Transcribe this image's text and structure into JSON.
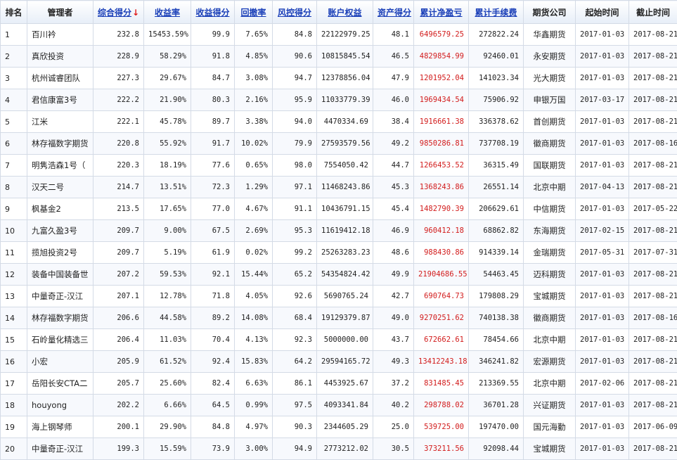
{
  "headers": [
    {
      "label": "排名",
      "sortable": false
    },
    {
      "label": "管理者",
      "sortable": false
    },
    {
      "label": "综合得分",
      "sortable": true,
      "sort_arrow": "↓"
    },
    {
      "label": "收益率",
      "sortable": true
    },
    {
      "label": "收益得分",
      "sortable": true
    },
    {
      "label": "回撤率",
      "sortable": true
    },
    {
      "label": "风控得分",
      "sortable": true
    },
    {
      "label": "账户权益",
      "sortable": true
    },
    {
      "label": "资产得分",
      "sortable": true
    },
    {
      "label": "累计净盈亏",
      "sortable": true
    },
    {
      "label": "累计手续费",
      "sortable": true
    },
    {
      "label": "期货公司",
      "sortable": false
    },
    {
      "label": "起始时间",
      "sortable": false
    },
    {
      "label": "截止时间",
      "sortable": false
    }
  ],
  "colors": {
    "link": "#1a3fb8",
    "profit": "#d21c1c",
    "sort_arrow": "#e01b1b"
  },
  "rows": [
    [
      "1",
      "百川衿",
      "232.8",
      "15453.59%",
      "99.9",
      "7.65%",
      "84.8",
      "22122979.25",
      "48.1",
      "6496579.25",
      "272822.24",
      "华鑫期货",
      "2017-01-03",
      "2017-08-21"
    ],
    [
      "2",
      "真欣投资",
      "228.9",
      "58.29%",
      "91.8",
      "4.85%",
      "90.6",
      "10815845.54",
      "46.5",
      "4829854.99",
      "92460.01",
      "永安期货",
      "2017-01-03",
      "2017-08-21"
    ],
    [
      "3",
      "杭州诚睿团队",
      "227.3",
      "29.67%",
      "84.7",
      "3.08%",
      "94.7",
      "12378856.04",
      "47.9",
      "1201952.04",
      "141023.34",
      "光大期货",
      "2017-01-03",
      "2017-08-21"
    ],
    [
      "4",
      "君信康富3号",
      "222.2",
      "21.90%",
      "80.3",
      "2.16%",
      "95.9",
      "11033779.39",
      "46.0",
      "1969434.54",
      "75906.92",
      "申银万国",
      "2017-03-17",
      "2017-08-21"
    ],
    [
      "5",
      "江米",
      "222.1",
      "45.78%",
      "89.7",
      "3.38%",
      "94.0",
      "4470334.69",
      "38.4",
      "1916661.38",
      "336378.62",
      "首创期货",
      "2017-01-03",
      "2017-08-21"
    ],
    [
      "6",
      "林存福数字期货",
      "220.8",
      "55.92%",
      "91.7",
      "10.02%",
      "79.9",
      "27593579.56",
      "49.2",
      "9850286.81",
      "737708.19",
      "徽商期货",
      "2017-01-03",
      "2017-08-16"
    ],
    [
      "7",
      "明隽浩森1号（",
      "220.3",
      "18.19%",
      "77.6",
      "0.65%",
      "98.0",
      "7554050.42",
      "44.7",
      "1266453.52",
      "36315.49",
      "国联期货",
      "2017-01-03",
      "2017-08-21"
    ],
    [
      "8",
      "汉天二号",
      "214.7",
      "13.51%",
      "72.3",
      "1.29%",
      "97.1",
      "11468243.86",
      "45.3",
      "1368243.86",
      "26551.14",
      "北京中期",
      "2017-04-13",
      "2017-08-21"
    ],
    [
      "9",
      "枫基金2",
      "213.5",
      "17.65%",
      "77.0",
      "4.67%",
      "91.1",
      "10436791.15",
      "45.4",
      "1482790.39",
      "206629.61",
      "中信期货",
      "2017-01-03",
      "2017-05-22"
    ],
    [
      "10",
      "九富久盈3号",
      "209.7",
      "9.00%",
      "67.5",
      "2.69%",
      "95.3",
      "11619412.18",
      "46.9",
      "960412.18",
      "68862.82",
      "东海期货",
      "2017-02-15",
      "2017-08-21"
    ],
    [
      "11",
      "揽旭投资2号",
      "209.7",
      "5.19%",
      "61.9",
      "0.02%",
      "99.2",
      "25263283.23",
      "48.6",
      "988430.86",
      "914339.14",
      "金瑞期货",
      "2017-05-31",
      "2017-07-31"
    ],
    [
      "12",
      "装备中国装备世",
      "207.2",
      "59.53%",
      "92.1",
      "15.44%",
      "65.2",
      "54354824.42",
      "49.9",
      "21904686.55",
      "54463.45",
      "迈科期货",
      "2017-01-03",
      "2017-08-21"
    ],
    [
      "13",
      "中量奇正-汉江",
      "207.1",
      "12.78%",
      "71.8",
      "4.05%",
      "92.6",
      "5690765.24",
      "42.7",
      "690764.73",
      "179808.29",
      "宝城期货",
      "2017-01-03",
      "2017-08-21"
    ],
    [
      "14",
      "林存福数字期货",
      "206.6",
      "44.58%",
      "89.2",
      "14.08%",
      "68.4",
      "19129379.87",
      "49.0",
      "9270251.62",
      "740138.38",
      "徽商期货",
      "2017-01-03",
      "2017-08-16"
    ],
    [
      "15",
      "石岭量化精选三",
      "206.4",
      "11.03%",
      "70.4",
      "4.13%",
      "92.3",
      "5000000.00",
      "43.7",
      "672662.61",
      "78454.66",
      "北京中期",
      "2017-01-03",
      "2017-08-21"
    ],
    [
      "16",
      "小宏",
      "205.9",
      "61.52%",
      "92.4",
      "15.83%",
      "64.2",
      "29594165.72",
      "49.3",
      "13412243.18",
      "346241.82",
      "宏源期货",
      "2017-01-03",
      "2017-08-21"
    ],
    [
      "17",
      "岳阳长安CTA二",
      "205.7",
      "25.60%",
      "82.4",
      "6.63%",
      "86.1",
      "4453925.67",
      "37.2",
      "831485.45",
      "213369.55",
      "北京中期",
      "2017-02-06",
      "2017-08-21"
    ],
    [
      "18",
      "houyong",
      "202.2",
      "6.66%",
      "64.5",
      "0.99%",
      "97.5",
      "4093341.84",
      "40.2",
      "298788.02",
      "36701.28",
      "兴证期货",
      "2017-01-03",
      "2017-08-21"
    ],
    [
      "19",
      "海上钢琴师",
      "200.1",
      "29.90%",
      "84.8",
      "4.97%",
      "90.3",
      "2344605.29",
      "25.0",
      "539725.00",
      "197470.00",
      "国元海勤",
      "2017-01-03",
      "2017-06-09"
    ],
    [
      "20",
      "中量奇正-汉江",
      "199.3",
      "15.59%",
      "73.9",
      "3.00%",
      "94.9",
      "2773212.02",
      "30.5",
      "373211.56",
      "92098.44",
      "宝城期货",
      "2017-01-03",
      "2017-08-21"
    ]
  ]
}
